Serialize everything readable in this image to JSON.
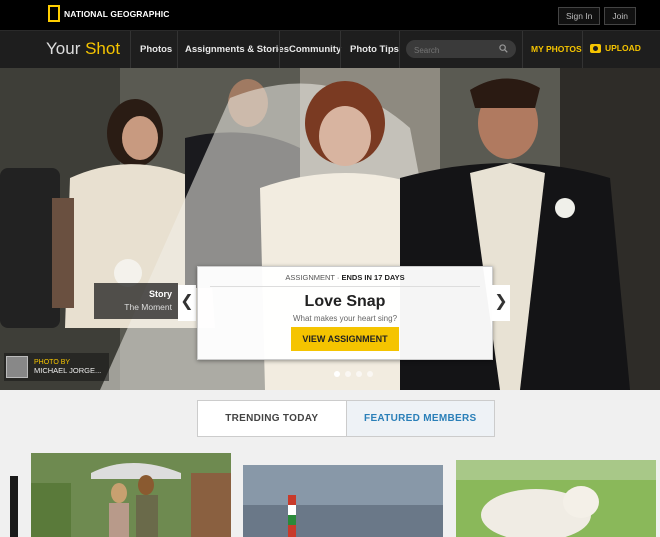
{
  "topbar": {
    "logo_text": "NATIONAL GEOGRAPHIC",
    "sign_in": "Sign In",
    "join": "Join"
  },
  "nav": {
    "brand_your": "Your",
    "brand_shot": "Shot",
    "items": [
      "Photos",
      "Assignments & Stories",
      "Community",
      "Photo Tips"
    ],
    "search_placeholder": "Search",
    "my_photos": "MY PHOTOS",
    "upload": "UPLOAD",
    "accent": "#f5c400"
  },
  "hero": {
    "story_label": "Story",
    "story_name": "The Moment",
    "assignment_prefix": "ASSIGNMENT · ",
    "assignment_deadline": "ENDS IN 17 DAYS",
    "title": "Love Snap",
    "subtitle": "What makes your heart sing?",
    "button": "VIEW ASSIGNMENT",
    "prev_arrow": "❮",
    "next_arrow": "❯",
    "photo_by_label": "PHOTO BY",
    "photographer": "MICHAEL JORGE..."
  },
  "tabs": {
    "trending": "TRENDING TODAY",
    "featured": "FEATURED MEMBERS",
    "featured_color": "#2a7fb8"
  }
}
